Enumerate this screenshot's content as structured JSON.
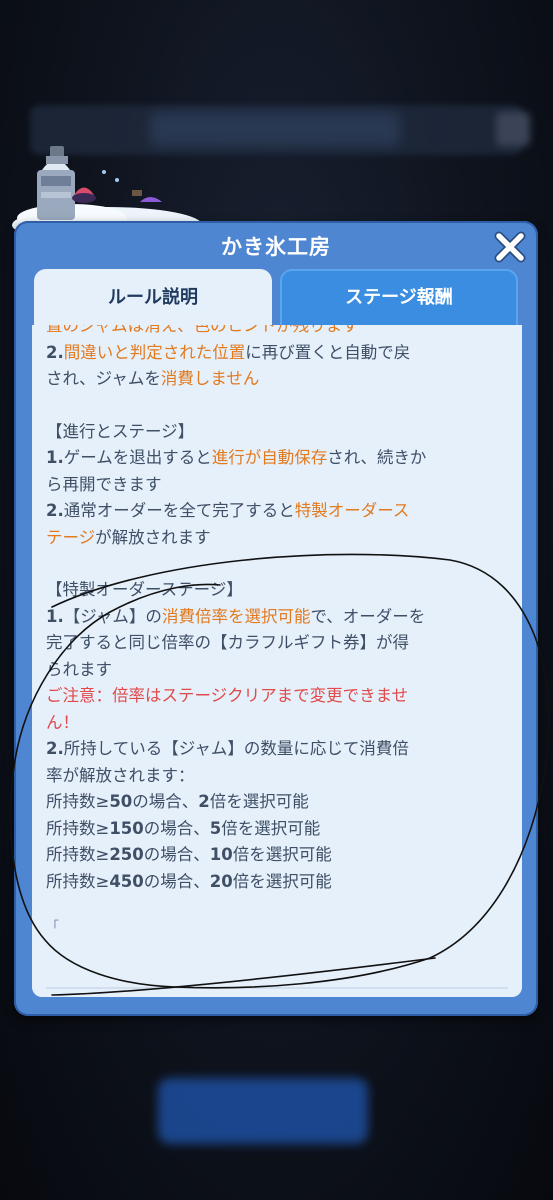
{
  "dialog": {
    "title": "かき氷工房",
    "tabs": [
      {
        "label": "ルール説明",
        "active": true
      },
      {
        "label": "ステージ報酬",
        "active": false
      }
    ]
  },
  "rules": {
    "cut_line": "置のジャムは消え、色のヒントが残ります",
    "mistake_line1_num": "2.",
    "mistake_line1_hl": "間違いと判定された位置",
    "mistake_line1_rest": "に再び置くと自動で戻",
    "mistake_line2_pre": "され、ジャムを",
    "mistake_line2_hl": "消費しません",
    "section1_heading": "【進行とステージ】",
    "s1_item1_num": "1.",
    "s1_item1_pre": "ゲームを退出すると",
    "s1_item1_hl": "進行が自動保存",
    "s1_item1_post": "され、続きか",
    "s1_item1_line2": "ら再開できます",
    "s1_item2_num": "2.",
    "s1_item2_pre": "通常オーダーを全て完了すると",
    "s1_item2_hl1": "特製オーダース",
    "s1_item2_hl2": "テージ",
    "s1_item2_post": "が解放されます",
    "section2_heading": "【特製オーダーステージ】",
    "s2_item1_num": "1.",
    "s2_item1_pre": "【ジャム】の",
    "s2_item1_hl": "消費倍率を選択可能",
    "s2_item1_post": "で、オーダーを",
    "s2_item1_line2": "完了すると同じ倍率の【カラフルギフト券】が得",
    "s2_item1_line3": "られます",
    "notice_line1": "ご注意：倍率はステージクリアまで変更できませ",
    "notice_line2": "ん！",
    "s2_item2_num": "2.",
    "s2_item2_line1": "所持している【ジャム】の数量に応じて消費倍",
    "s2_item2_line2": "率が解放されます：",
    "tiers": [
      {
        "pre": "所持数≥",
        "count": "50",
        "mid": "の場合、",
        "mult": "2",
        "post": "倍を選択可能"
      },
      {
        "pre": "所持数≥",
        "count": "150",
        "mid": "の場合、",
        "mult": "5",
        "post": "倍を選択可能"
      },
      {
        "pre": "所持数≥",
        "count": "250",
        "mid": "の場合、",
        "mult": "10",
        "post": "倍を選択可能"
      },
      {
        "pre": "所持数≥",
        "count": "450",
        "mid": "の場合、",
        "mult": "20",
        "post": "倍を選択可能"
      }
    ],
    "trailing_bracket": "「"
  },
  "icons": {
    "close": "close-icon",
    "decoration": "ice-shaved-machine-illustration"
  },
  "colors": {
    "dialog_blue": "#4f86d2",
    "panel_bg": "#e6f0fb",
    "highlight_orange": "#e27a1f",
    "highlight_red": "#e14a4a",
    "active_tab_text": "#1f3a5e",
    "inactive_tab_bg": "#3a8de0"
  }
}
